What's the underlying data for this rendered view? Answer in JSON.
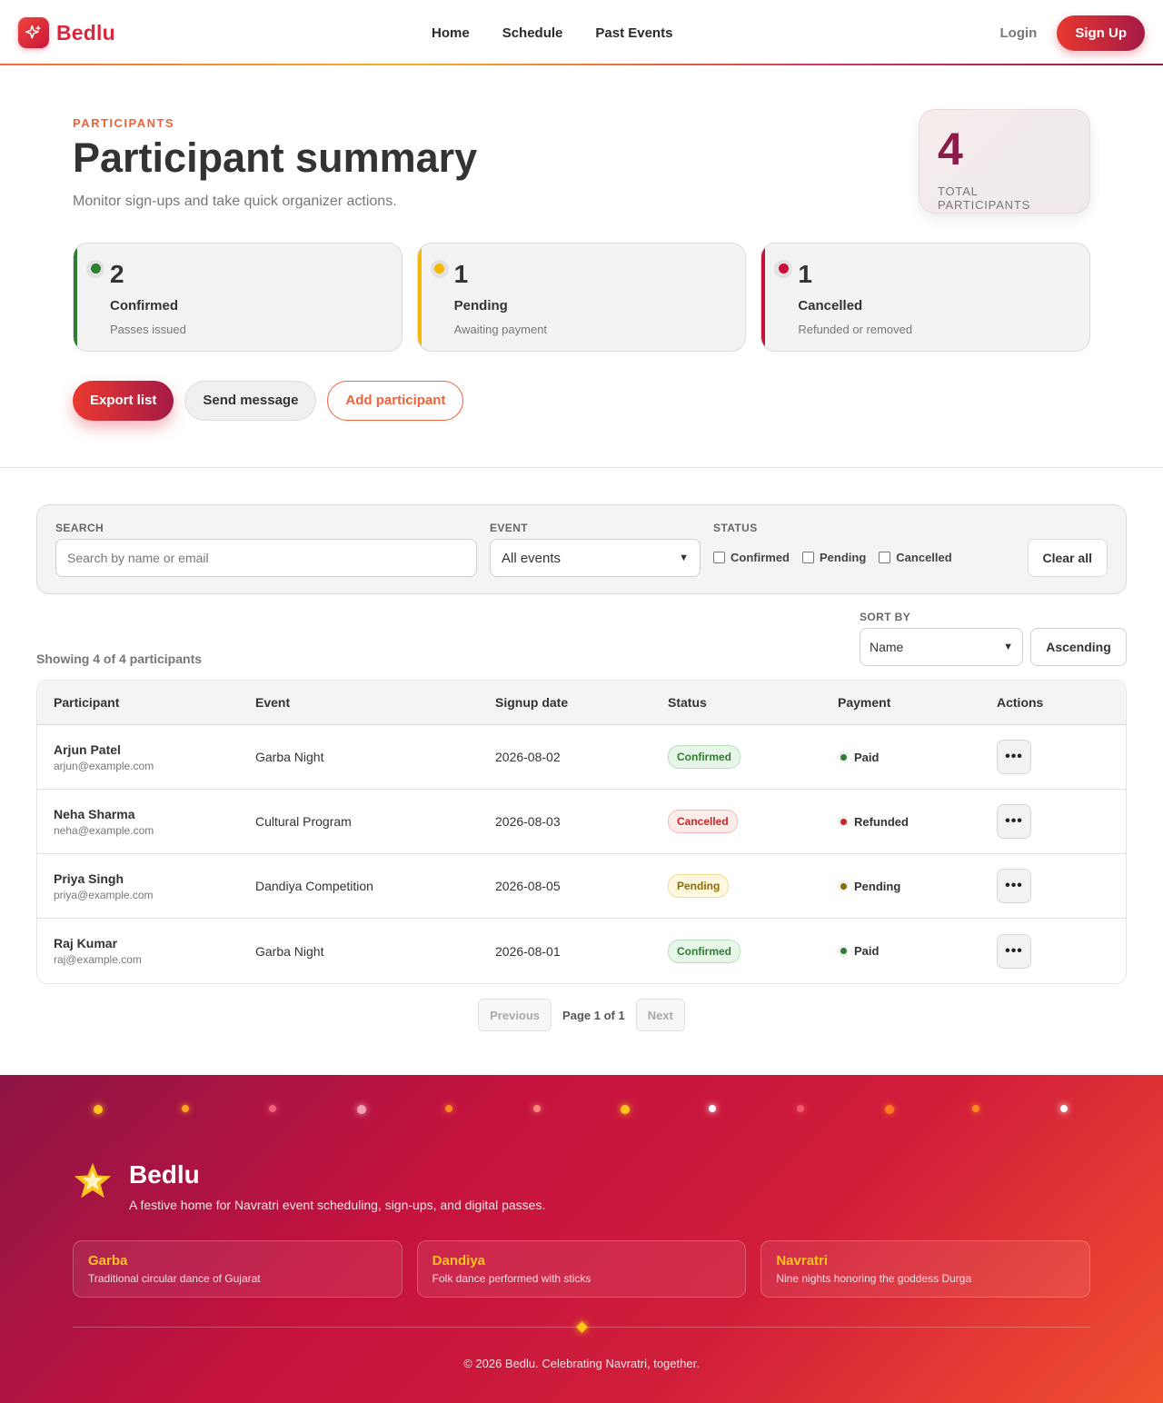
{
  "nav": {
    "brand": "Bedlu",
    "links": [
      "Home",
      "Schedule",
      "Past Events"
    ],
    "login": "Login",
    "signup": "Sign Up"
  },
  "hero": {
    "eyebrow": "PARTICIPANTS",
    "title": "Participant summary",
    "subtitle": "Monitor sign-ups and take quick organizer actions.",
    "total": {
      "value": "4",
      "label": "TOTAL PARTICIPANTS"
    },
    "stats": [
      {
        "value": "2",
        "label": "Confirmed",
        "desc": "Passes issued",
        "color": "#2e7d32"
      },
      {
        "value": "1",
        "label": "Pending",
        "desc": "Awaiting payment",
        "color": "#f5b800"
      },
      {
        "value": "1",
        "label": "Cancelled",
        "desc": "Refunded or removed",
        "color": "#c8103e"
      }
    ],
    "actions": {
      "export": "Export list",
      "message": "Send message",
      "add": "Add participant"
    }
  },
  "filters": {
    "search_label": "SEARCH",
    "search_placeholder": "Search by name or email",
    "event_label": "EVENT",
    "event_value": "All events",
    "status_label": "STATUS",
    "statuses": [
      "Confirmed",
      "Pending",
      "Cancelled"
    ],
    "clear": "Clear all"
  },
  "sort": {
    "showing": "Showing 4 of 4 participants",
    "label": "SORT BY",
    "value": "Name",
    "order": "Ascending"
  },
  "table": {
    "headers": [
      "Participant",
      "Event",
      "Signup date",
      "Status",
      "Payment",
      "Actions"
    ],
    "rows": [
      {
        "name": "Arjun Patel",
        "email": "arjun@example.com",
        "event": "Garba Night",
        "date": "2026-08-02",
        "status": "Confirmed",
        "payment": "Paid"
      },
      {
        "name": "Neha Sharma",
        "email": "neha@example.com",
        "event": "Cultural Program",
        "date": "2026-08-03",
        "status": "Cancelled",
        "payment": "Refunded"
      },
      {
        "name": "Priya Singh",
        "email": "priya@example.com",
        "event": "Dandiya Competition",
        "date": "2026-08-05",
        "status": "Pending",
        "payment": "Pending"
      },
      {
        "name": "Raj Kumar",
        "email": "raj@example.com",
        "event": "Garba Night",
        "date": "2026-08-01",
        "status": "Confirmed",
        "payment": "Paid"
      }
    ],
    "more_icon": "•••"
  },
  "pager": {
    "previous": "Previous",
    "info": "Page 1 of 1",
    "next": "Next"
  },
  "status_styles": {
    "Confirmed": {
      "fg": "#2e7d32",
      "bg": "#e8f5e9",
      "border": "#b9dfbc"
    },
    "Cancelled": {
      "fg": "#c62828",
      "bg": "#fdecea",
      "border": "#f3b8b8"
    },
    "Pending": {
      "fg": "#8a6d00",
      "bg": "#fff8e1",
      "border": "#f3dc8e"
    }
  },
  "payment_colors": {
    "Paid": "#2e7d32",
    "Refunded": "#c62828",
    "Pending": "#8a6d00"
  },
  "footer": {
    "brand": "Bedlu",
    "tagline": "A festive home for Navratri event scheduling, sign-ups, and digital passes.",
    "cards": [
      {
        "title": "Garba",
        "desc": "Traditional circular dance of Gujarat"
      },
      {
        "title": "Dandiya",
        "desc": "Folk dance performed with sticks"
      },
      {
        "title": "Navratri",
        "desc": "Nine nights honoring the goddess Durga"
      }
    ],
    "copyright": "© 2026 Bedlu. Celebrating Navratri, together.",
    "light_colors": [
      "#ffc31e",
      "#ffa51e",
      "#f0607a",
      "#f6a0b8",
      "#ff8a1e",
      "#ff8a7a",
      "#ffc31e",
      "#ffffff",
      "#f05a6a",
      "#ff7a1e",
      "#ff8a1e",
      "#ffffff"
    ]
  },
  "icons": {
    "logo": "sparkle-icon",
    "star": "star-icon",
    "chevron": "chevron-down-icon",
    "more": "more-icon"
  }
}
